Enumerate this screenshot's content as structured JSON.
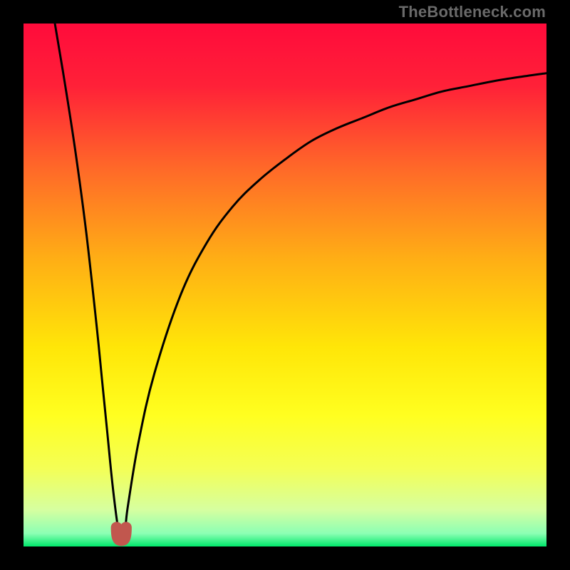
{
  "watermark": "TheBottleneck.com",
  "chart_data": {
    "type": "line",
    "title": "",
    "xlabel": "",
    "ylabel": "",
    "xlim": [
      0,
      100
    ],
    "ylim": [
      0,
      100
    ],
    "series": [
      {
        "name": "bottleneck-curve",
        "x": [
          6,
          8,
          10,
          12,
          14,
          15,
          16,
          17,
          18,
          18.5,
          19,
          19.5,
          20,
          22,
          25,
          30,
          35,
          40,
          45,
          50,
          55,
          60,
          65,
          70,
          75,
          80,
          85,
          90,
          95,
          100
        ],
        "values": [
          100,
          88,
          75,
          60,
          42,
          32,
          22,
          12,
          4,
          2,
          2,
          4,
          8,
          20,
          33,
          48,
          58,
          65,
          70,
          74,
          77.5,
          80,
          82,
          84,
          85.5,
          87,
          88,
          89,
          89.8,
          90.5
        ]
      }
    ],
    "marker": {
      "name": "minimum-region",
      "x_range": [
        17.8,
        19.6
      ],
      "y": 2,
      "color": "#c1574e"
    },
    "background_gradient": {
      "stops": [
        {
          "pos": 0.0,
          "color": "#ff0b3b"
        },
        {
          "pos": 0.12,
          "color": "#ff2138"
        },
        {
          "pos": 0.28,
          "color": "#ff6a28"
        },
        {
          "pos": 0.45,
          "color": "#ffae15"
        },
        {
          "pos": 0.62,
          "color": "#ffe608"
        },
        {
          "pos": 0.75,
          "color": "#ffff20"
        },
        {
          "pos": 0.85,
          "color": "#f4ff55"
        },
        {
          "pos": 0.93,
          "color": "#d6ffa0"
        },
        {
          "pos": 0.975,
          "color": "#8cffb4"
        },
        {
          "pos": 1.0,
          "color": "#00e86b"
        }
      ]
    }
  }
}
